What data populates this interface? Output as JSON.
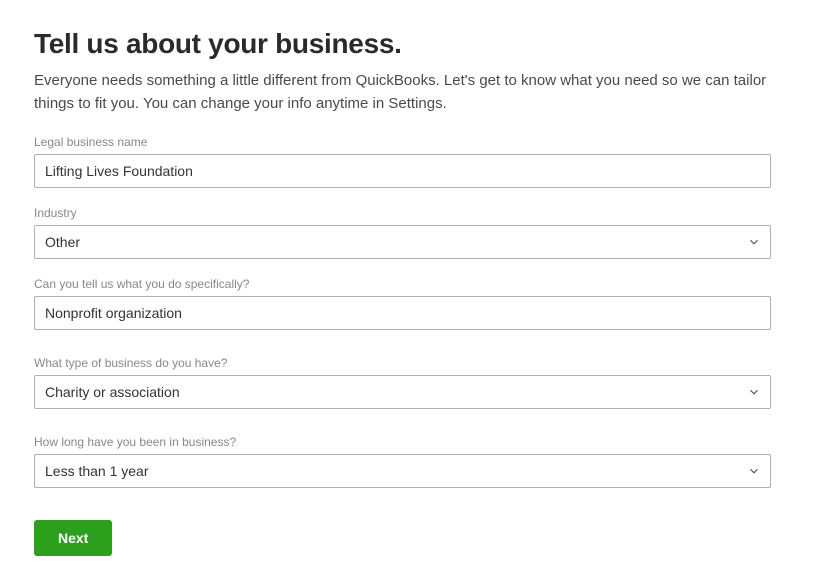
{
  "header": {
    "title": "Tell us about your business.",
    "subtitle": "Everyone needs something a little different from QuickBooks. Let's get to know what you need so we can tailor things to fit you. You can change your info anytime in Settings."
  },
  "form": {
    "legal_name": {
      "label": "Legal business name",
      "value": "Lifting Lives Foundation"
    },
    "industry": {
      "label": "Industry",
      "value": "Other"
    },
    "specific": {
      "label": "Can you tell us what you do specifically?",
      "value": "Nonprofit organization"
    },
    "business_type": {
      "label": "What type of business do you have?",
      "value": "Charity or association"
    },
    "duration": {
      "label": "How long have you been in business?",
      "value": "Less than 1 year"
    }
  },
  "buttons": {
    "next": "Next"
  }
}
